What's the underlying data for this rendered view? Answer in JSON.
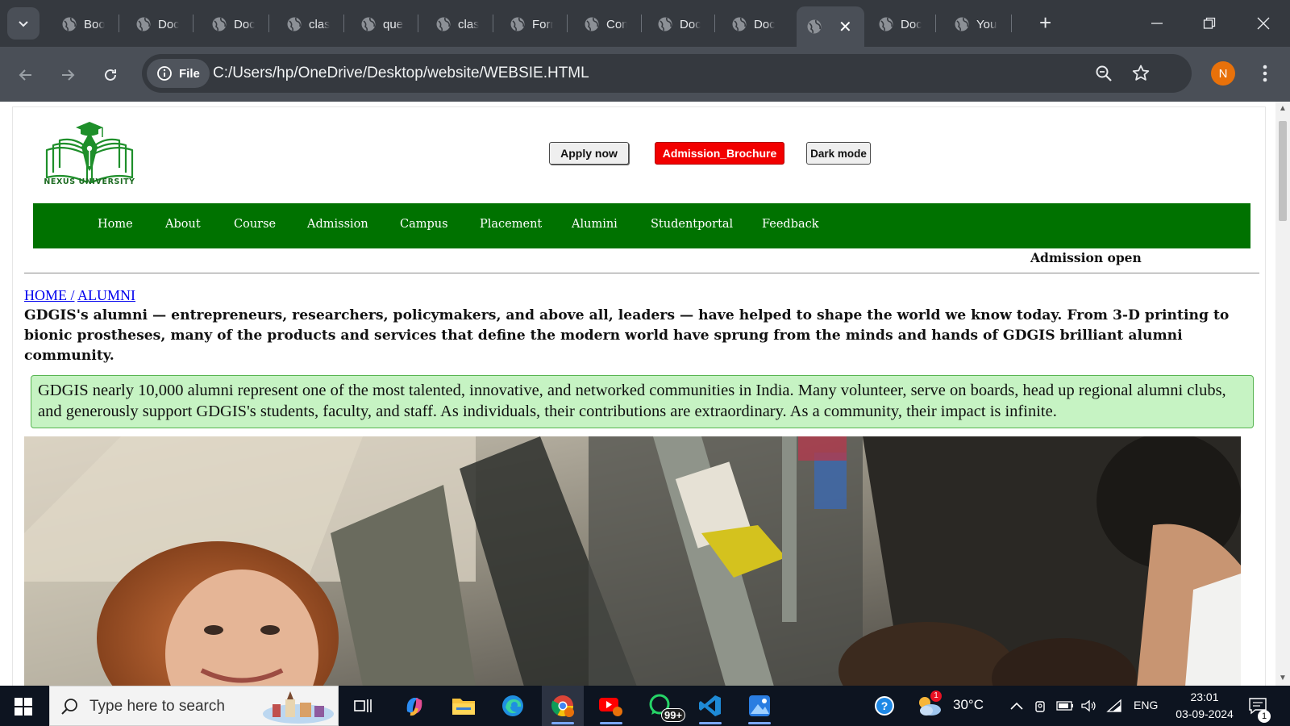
{
  "browser": {
    "tabs": [
      {
        "title": "Boo"
      },
      {
        "title": "Doc"
      },
      {
        "title": "Doc"
      },
      {
        "title": "clas"
      },
      {
        "title": "que"
      },
      {
        "title": "clas"
      },
      {
        "title": "Forr"
      },
      {
        "title": "Con"
      },
      {
        "title": "Doc"
      },
      {
        "title": "Doc"
      },
      {
        "title": ""
      },
      {
        "title": "Doc"
      },
      {
        "title": "You"
      }
    ],
    "site_chip": "File",
    "url": "C:/Users/hp/OneDrive/Desktop/website/WEBSIE.HTML",
    "profile_initial": "N"
  },
  "page": {
    "logo_text": "NEXUS UNIVERSITY",
    "buttons": {
      "apply": "Apply now",
      "brochure": "Admission_Brochure",
      "dark": "Dark mode"
    },
    "nav": [
      "Home",
      "About",
      "Course",
      "Admission",
      "Campus",
      "Placement",
      "Alumini",
      "Studentportal",
      "Feedback"
    ],
    "marquee": "Admission open",
    "breadcrumb": {
      "home": "HOME /",
      "current": "ALUMNI"
    },
    "intro": "GDGIS's alumni — entrepreneurs, researchers, policymakers, and above all, leaders — have helped to shape the world we know today. From 3-D printing to bionic prostheses, many of the products and services that define the modern world have sprung from the minds and hands of GDGIS brilliant alumni community.",
    "highlight": "GDGIS nearly 10,000 alumni represent one of the most talented, innovative, and networked communities in India. Many volunteer, serve on boards, head up regional alumni clubs, and generously support GDGIS's students, faculty, and staff. As individuals, their contributions are extraordinary. As a community, their impact is infinite.",
    "colors": {
      "nav_bg": "#007200",
      "brochure_bg": "#f20000",
      "highlight_bg": "#c6f3c3",
      "highlight_border": "#58b552"
    }
  },
  "taskbar": {
    "search_placeholder": "Type here to search",
    "whatsapp_badge": "99+",
    "weather": "30°C",
    "language": "ENG",
    "time": "23:01",
    "date": "03-09-2024",
    "notification_count": "1",
    "weather_alert": "1"
  }
}
